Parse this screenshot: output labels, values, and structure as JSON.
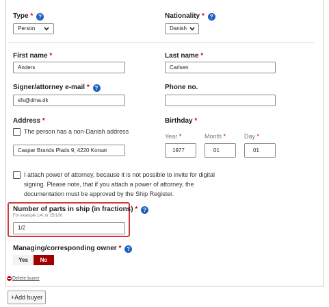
{
  "type_field": {
    "label": "Type",
    "value": "Person"
  },
  "nationality_field": {
    "label": "Nationality",
    "value": "Danish"
  },
  "first_name": {
    "label": "First name",
    "value": "Anders"
  },
  "last_name": {
    "label": "Last name",
    "value": "Carlsen"
  },
  "email": {
    "label": "Signer/attorney e-mail",
    "value": "sfs@dma.dk"
  },
  "phone": {
    "label": "Phone no.",
    "value": ""
  },
  "address": {
    "label": "Address",
    "non_danish_checkbox": "The person has a non-Danish address",
    "value": "Caspar Brands Plads 9, 4220 Korsør"
  },
  "birthday": {
    "label": "Birthday",
    "year_label": "Year",
    "month_label": "Month",
    "day_label": "Day",
    "year": "1977",
    "month": "01",
    "day": "01"
  },
  "power_of_attorney": {
    "line1": "I attach power of attorney, because it is not possible to invite for digital",
    "line2": "signing. Please note, that if you attach a power of attorney, the",
    "line3": "documentation must be approved by the Ship Register."
  },
  "parts": {
    "label": "Number of parts in ship (in fractions)",
    "hint": "For example 1/4, or 25/100",
    "value": "1/2"
  },
  "managing_owner": {
    "label": "Managing/corresponding owner",
    "yes": "Yes",
    "no": "No",
    "selected": "No"
  },
  "delete_buyer": "Delete buyer",
  "add_buyer": "+Add buyer",
  "required_mark": "*",
  "help_glyph": "?",
  "colors": {
    "required": "#c00000",
    "help": "#1f5fbf",
    "highlight": "#d23a3a",
    "selected_toggle": "#a00000"
  },
  "icons": [
    "help-icon",
    "chevron-down-icon",
    "delete-icon"
  ]
}
